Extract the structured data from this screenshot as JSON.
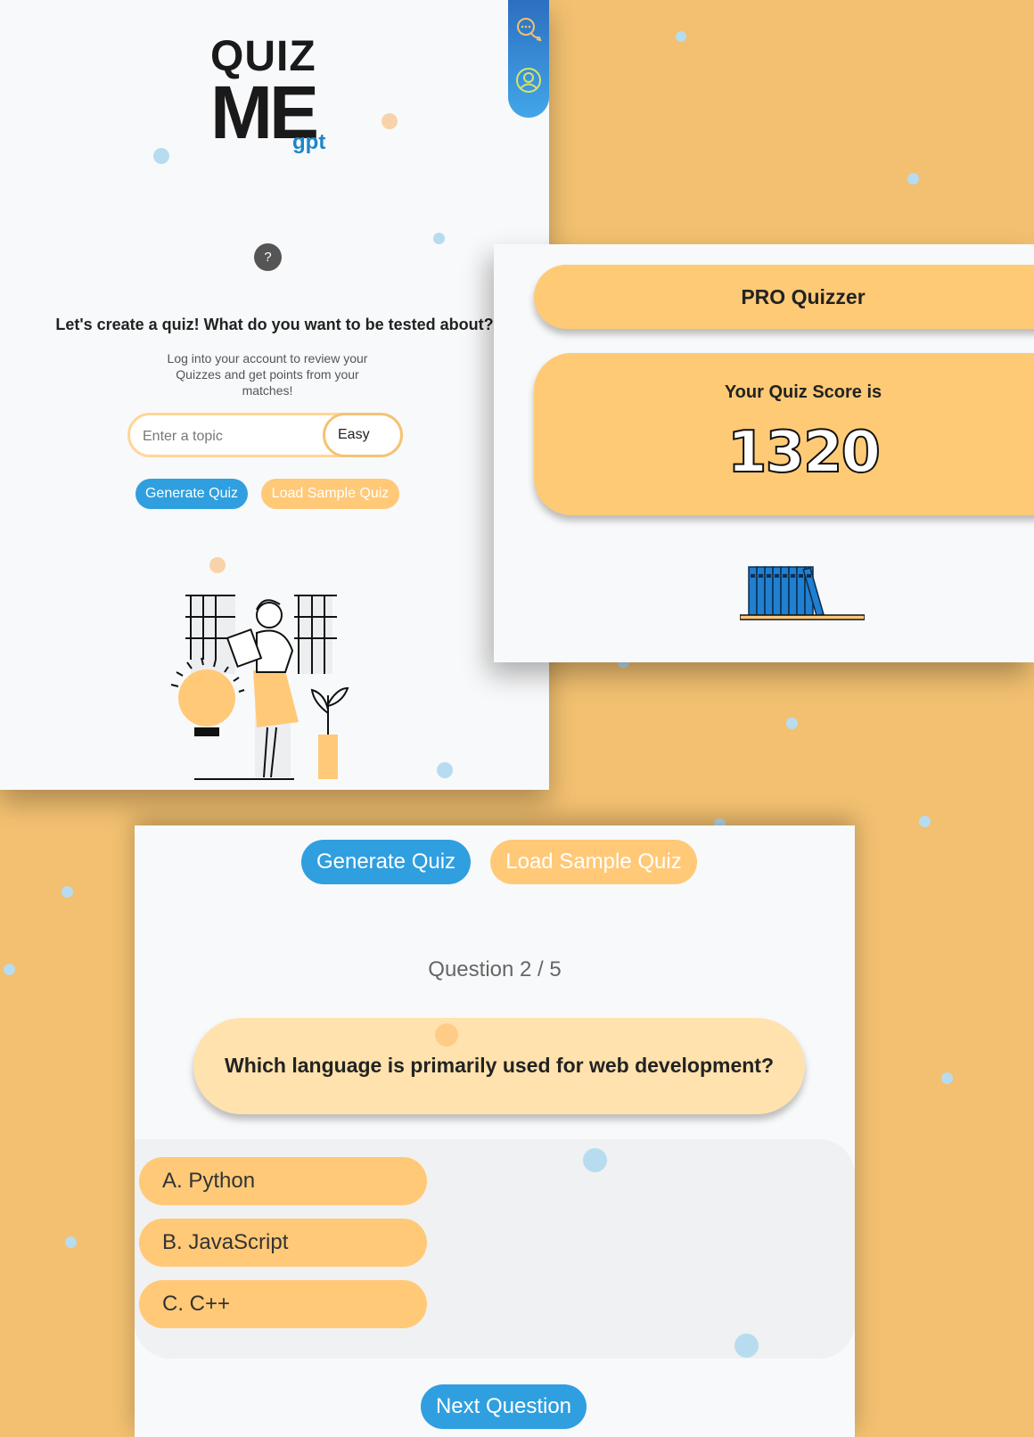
{
  "creator": {
    "logo": {
      "line1": "QUIZ",
      "line2": "ME",
      "line3": "gpt"
    },
    "help_label": "?",
    "title": "Let's create a quiz! What do you want to be tested about?",
    "subtitle": "Log into your account to review your Quizzes and get points from your matches!",
    "topic_placeholder": "Enter a topic",
    "difficulty": "Easy",
    "generate_label": "Generate Quiz",
    "load_sample_label": "Load Sample Quiz",
    "rail_icons": [
      "chat-icon",
      "user-icon"
    ]
  },
  "score": {
    "rank": "PRO Quizzer",
    "label": "Your Quiz Score is",
    "value": "1320"
  },
  "quiz": {
    "generate_label": "Generate Quiz",
    "load_sample_label": "Load Sample Quiz",
    "progress": "Question 2 / 5",
    "question": "Which language is primarily used for web development?",
    "answers": [
      "A. Python",
      "B. JavaScript",
      "C. C++"
    ],
    "next_label": "Next Question"
  },
  "colors": {
    "background": "#f2c070",
    "primary_blue": "#2f9fe0",
    "accent_orange": "#ffc978",
    "question_bg": "#ffe2ad"
  }
}
